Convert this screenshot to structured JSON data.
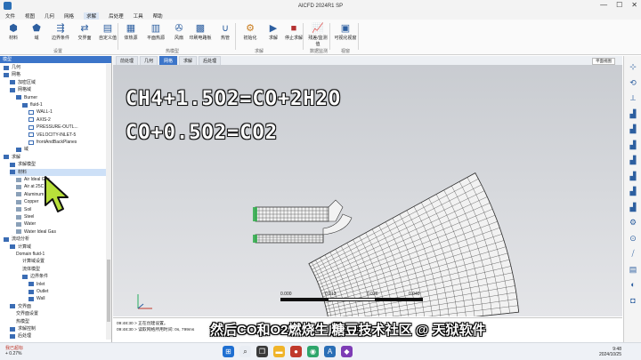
{
  "window": {
    "title": "AICFD 2024R1 SP",
    "min": "—",
    "max": "☐",
    "close": "✕"
  },
  "menu": [
    "文件",
    "视图",
    "几何",
    "网格",
    "求解",
    "后处理",
    "工具",
    "帮助"
  ],
  "menu_active_index": 4,
  "ribbon": {
    "buttons": [
      {
        "label": "材料",
        "icon": "materials-icon",
        "glyph": "⬢"
      },
      {
        "label": "域",
        "icon": "domain-icon",
        "glyph": "⬟"
      },
      {
        "label": "边界条件",
        "icon": "boundary-conditions-icon",
        "glyph": "⇶"
      },
      {
        "label": "交界面",
        "icon": "interface-icon",
        "glyph": "⇄"
      },
      {
        "label": "自定义值",
        "icon": "custom-value-icon",
        "glyph": "▤"
      },
      {
        "label": "体热源",
        "icon": "volume-heat-source-icon",
        "glyph": "▦"
      },
      {
        "label": "平面热源",
        "icon": "plane-heat-source-icon",
        "glyph": "▥"
      },
      {
        "label": "风扇",
        "icon": "fan-icon",
        "glyph": "✇"
      },
      {
        "label": "印刷电路板",
        "icon": "pcb-icon",
        "glyph": "▩"
      },
      {
        "label": "热管",
        "icon": "heat-pipe-icon",
        "glyph": "∪"
      },
      {
        "label": "初始化",
        "icon": "initialize-icon",
        "glyph": "⚙"
      },
      {
        "label": "求解",
        "icon": "solve-icon",
        "glyph": "▶"
      },
      {
        "label": "停止求解",
        "icon": "stop-solve-icon",
        "glyph": "■"
      },
      {
        "label": "残差/监测值",
        "icon": "residual-monitor-icon",
        "glyph": "📈"
      },
      {
        "label": "可视化视窗",
        "icon": "visualization-window-icon",
        "glyph": "▣"
      }
    ],
    "groups": [
      "设置",
      "热模型",
      "求解",
      "数据监测",
      "视窗"
    ]
  },
  "tree": {
    "header": "模型",
    "items": [
      {
        "label": "几何",
        "level": 0,
        "icon": "box"
      },
      {
        "label": "网格",
        "level": 0,
        "icon": "box"
      },
      {
        "label": "加密区域",
        "level": 1,
        "icon": "box"
      },
      {
        "label": "网格域",
        "level": 1,
        "icon": "box"
      },
      {
        "label": "Burner",
        "level": 2,
        "icon": "box"
      },
      {
        "label": "fluid-1",
        "level": 3,
        "icon": "box"
      },
      {
        "label": "WALL-1",
        "level": 4,
        "icon": "check"
      },
      {
        "label": "AXIS-2",
        "level": 4,
        "icon": "check"
      },
      {
        "label": "PRESSURE-OUTL...",
        "level": 4,
        "icon": "check"
      },
      {
        "label": "VELOCITY-INLET-5",
        "level": 4,
        "icon": "check"
      },
      {
        "label": "frontAndBackPlanes",
        "level": 4,
        "icon": "check"
      },
      {
        "label": "域",
        "level": 2,
        "icon": "box"
      },
      {
        "label": "求解",
        "level": 0,
        "icon": "box"
      },
      {
        "label": "求解模型",
        "level": 1,
        "icon": "box"
      },
      {
        "label": "材料",
        "level": 1,
        "icon": "box",
        "selected": true
      },
      {
        "label": "Air Ideal Gas",
        "level": 2,
        "icon": "gray"
      },
      {
        "label": "Air at 25C",
        "level": 2,
        "icon": "gray"
      },
      {
        "label": "Aluminum",
        "level": 2,
        "icon": "gray"
      },
      {
        "label": "Copper",
        "level": 2,
        "icon": "gray"
      },
      {
        "label": "Soil",
        "level": 2,
        "icon": "gray"
      },
      {
        "label": "Steel",
        "level": 2,
        "icon": "gray"
      },
      {
        "label": "Water",
        "level": 2,
        "icon": "gray"
      },
      {
        "label": "Water Ideal Gas",
        "level": 2,
        "icon": "gray"
      },
      {
        "label": "流动分析",
        "level": 0,
        "icon": "box"
      },
      {
        "label": "计算域",
        "level": 1,
        "icon": "box"
      },
      {
        "label": "Domain fluid-1",
        "level": 2,
        "icon": "none"
      },
      {
        "label": "计算域设置",
        "level": 3,
        "icon": "none"
      },
      {
        "label": "流体模型",
        "level": 3,
        "icon": "none"
      },
      {
        "label": "边界条件",
        "level": 3,
        "icon": "box"
      },
      {
        "label": "Inlet",
        "level": 4,
        "icon": "box"
      },
      {
        "label": "Outlet",
        "level": 4,
        "icon": "box"
      },
      {
        "label": "Wall",
        "level": 4,
        "icon": "box"
      },
      {
        "label": "交界面",
        "level": 1,
        "icon": "box"
      },
      {
        "label": "交界面设置",
        "level": 2,
        "icon": "none"
      },
      {
        "label": "热模型",
        "level": 2,
        "icon": "none"
      },
      {
        "label": "求解控制",
        "level": 1,
        "icon": "box"
      },
      {
        "label": "后处理",
        "level": 1,
        "icon": "box"
      }
    ]
  },
  "graphics_tabs": [
    "前处理",
    "几何",
    "网格",
    "求解",
    "后处理"
  ],
  "graphics_tab_active": 2,
  "view_selector": "平面视图",
  "overlay_equations": [
    "CH4+1.5O2=CO+2H2O",
    "CO+0.5O2=CO2"
  ],
  "scale_bar": {
    "ticks": [
      "0.000",
      "0.013",
      "0.026",
      "0.040"
    ]
  },
  "console_lines": [
    "09:48:30 > 正在创建设置。",
    "09:48:30 > 读取网格所用时间: 0s, 799ms"
  ],
  "subtitle": "然后CO和O2燃烧生成CO2",
  "watermark": "糖豆技术社区 @ 天狱软件",
  "taskbar": {
    "weather_temp": "我已超标",
    "weather_sub": "+ 0.27%",
    "time": "9:48",
    "date": "2024/10/25"
  },
  "colors": {
    "accent": "#3c75c9",
    "mesh_line": "#333333",
    "mesh_fill": "#f2f2f2",
    "inlet_green": "#2fae4a",
    "cursor_fill": "#b8e03a"
  }
}
